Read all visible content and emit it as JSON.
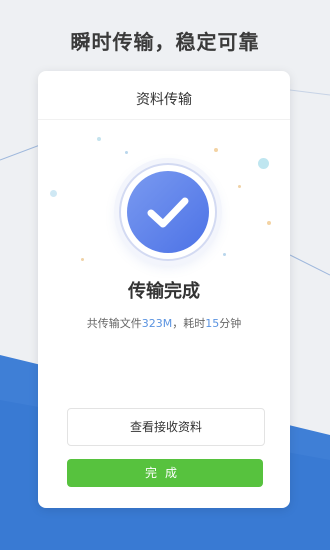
{
  "headline": "瞬时传输，稳定可靠",
  "card": {
    "title": "资料传输",
    "status_title": "传输完成",
    "summary": {
      "prefix": "共传输文件",
      "size": "323M",
      "middle": "，耗时",
      "duration": "15",
      "suffix": "分钟"
    },
    "view_button_label": "查看接收资料",
    "done_button_label": "完成"
  },
  "colors": {
    "accent_blue": "#4c72e6",
    "highlight_blue": "#5a93e0",
    "done_green": "#57c23e",
    "background": "#eef0f3",
    "bottom_band": "#3f7fd6"
  },
  "icons": {
    "status": "checkmark-icon"
  }
}
